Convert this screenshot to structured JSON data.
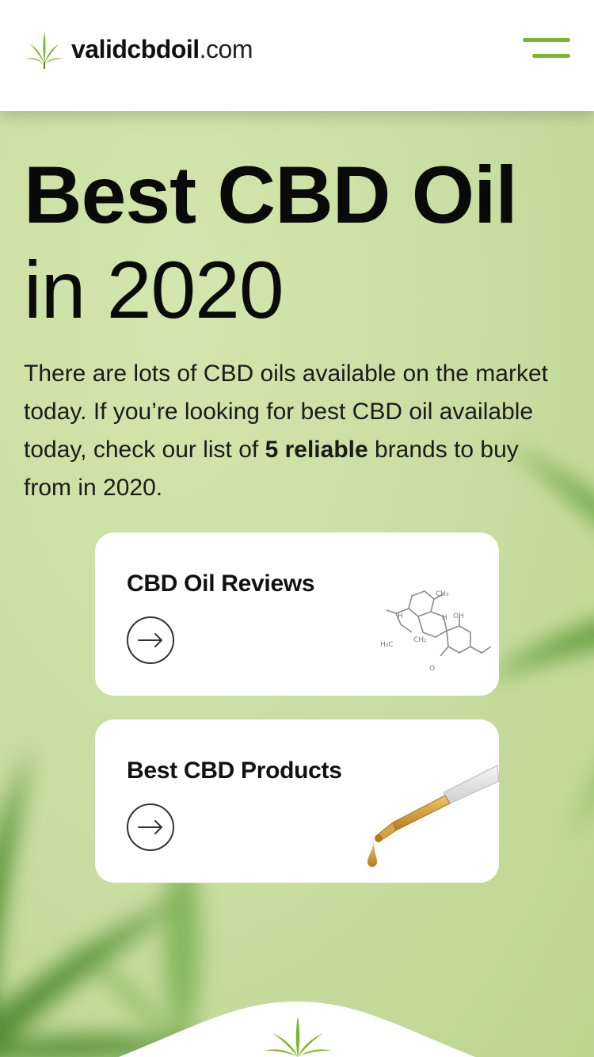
{
  "header": {
    "logo_bold": "validcbdoil",
    "logo_suffix": ".com",
    "logo_icon": "cannabis-leaf-icon",
    "menu_icon": "hamburger-menu-icon"
  },
  "hero": {
    "title_line1": "Best CBD Oil",
    "title_line2": "in 2020",
    "desc_before": "There are lots of CBD oils available on the market today. If you’re looking for best CBD oil available today, check our list of ",
    "desc_bold": "5 reliable",
    "desc_after": " brands to buy from in 2020."
  },
  "cards": [
    {
      "title": "CBD Oil Reviews",
      "icon": "arrow-right-icon",
      "art": "cbd-molecule"
    },
    {
      "title": "Best CBD Products",
      "icon": "arrow-right-icon",
      "art": "oil-dropper"
    }
  ],
  "molecule_labels": [
    "CH₃",
    "OH",
    "H",
    "H",
    "H₃C",
    "CH₂",
    "O"
  ],
  "colors": {
    "accent": "#7cb82f",
    "background": "#c9dfa0",
    "card": "#ffffff",
    "text": "#111111"
  }
}
